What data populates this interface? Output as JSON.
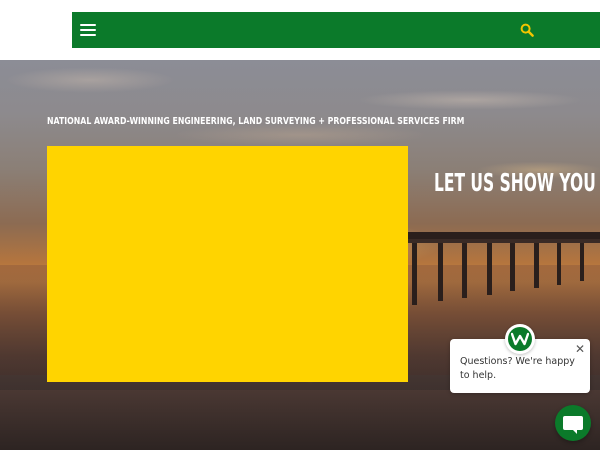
{
  "header": {
    "menu_icon": "hamburger-menu-icon",
    "search_icon": "search-icon"
  },
  "hero": {
    "tagline": "National Award-Winning Engineering, Land Surveying + Professional Services Firm",
    "headline": "Let Us Show You"
  },
  "chat": {
    "message": "Questions? We're happy to help.",
    "avatar_icon": "brand-w-logo-icon",
    "close_icon": "close-icon",
    "launcher_icon": "chat-bubble-icon"
  },
  "colors": {
    "brand_green": "#0b7a2a",
    "search_yellow": "#f2c500",
    "video_yellow": "#ffd400",
    "white": "#ffffff"
  }
}
